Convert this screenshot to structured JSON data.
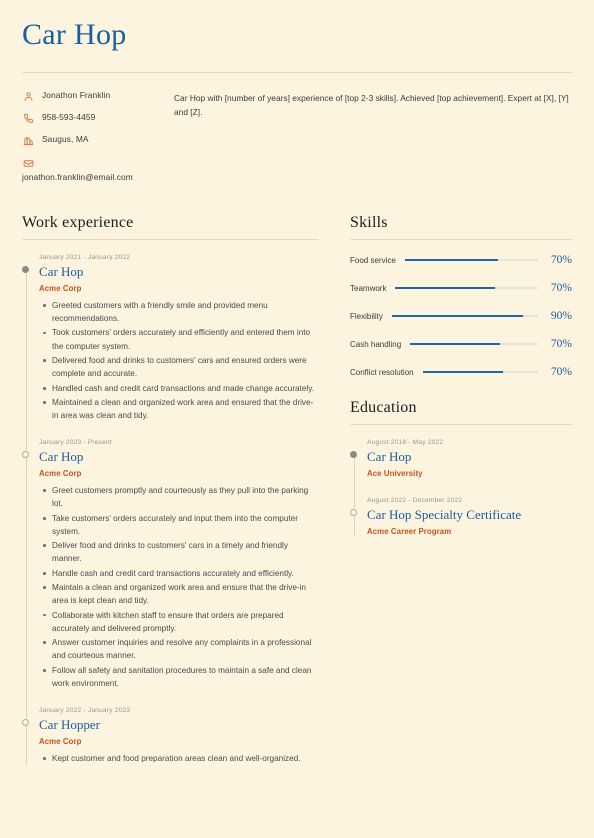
{
  "header": {
    "name_title": "Car Hop",
    "contacts": [
      {
        "icon": "person-icon",
        "text": "Jonathon Franklin"
      },
      {
        "icon": "phone-icon",
        "text": "958-593-4459"
      },
      {
        "icon": "location-icon",
        "text": "Saugus, MA"
      },
      {
        "icon": "email-icon",
        "text": "jonathon.franklin@email.com"
      }
    ],
    "summary": "Car Hop with [number of years] experience of [top 2-3 skills]. Achieved [top achievement]. Expert at [X], [Y] and [Z]."
  },
  "work": {
    "title": "Work experience",
    "entries": [
      {
        "marker": "filled",
        "date": "January 2021 - January 2022",
        "role": "Car Hop",
        "org": "Acme Corp",
        "bullets": [
          "Greeted customers with a friendly smile and provided menu recommendations.",
          "Took customers' orders accurately and efficiently and entered them into the computer system.",
          "Delivered food and drinks to customers' cars and ensured orders were complete and accurate.",
          "Handled cash and credit card transactions and made change accurately.",
          "Maintained a clean and organized work area and ensured that the drive-in area was clean and tidy."
        ]
      },
      {
        "marker": "hollow",
        "date": "January 2023 - Present",
        "role": "Car Hop",
        "org": "Acme Corp",
        "bullets": [
          "Greet customers promptly and courteously as they pull into the parking lot.",
          "Take customers' orders accurately and input them into the computer system.",
          "Deliver food and drinks to customers' cars in a timely and friendly manner.",
          "Handle cash and credit card transactions accurately and efficiently.",
          "Maintain a clean and organized work area and ensure that the drive-in area is kept clean and tidy.",
          "Collaborate with kitchen staff to ensure that orders are prepared accurately and delivered promptly.",
          "Answer customer inquiries and resolve any complaints in a professional and courteous manner.",
          "Follow all safety and sanitation procedures to maintain a safe and clean work environment."
        ]
      },
      {
        "marker": "hollow",
        "date": "January 2022 - January 2023",
        "role": "Car Hopper",
        "org": "Acme Corp",
        "bullets": [
          "Kept customer and food preparation areas clean and well-organized."
        ]
      }
    ]
  },
  "skills": {
    "title": "Skills",
    "items": [
      {
        "name": "Food service",
        "percent_label": "70%",
        "value": 70
      },
      {
        "name": "Teamwork",
        "percent_label": "70%",
        "value": 70
      },
      {
        "name": "Flexibility",
        "percent_label": "90%",
        "value": 90
      },
      {
        "name": "Cash handling",
        "percent_label": "70%",
        "value": 70
      },
      {
        "name": "Conflict resolution",
        "percent_label": "70%",
        "value": 70
      }
    ]
  },
  "education": {
    "title": "Education",
    "entries": [
      {
        "marker": "filled",
        "date": "August 2018 - May 2022",
        "degree": "Car Hop",
        "school": "Ace University"
      },
      {
        "marker": "hollow",
        "date": "August 2022 - December 2022",
        "degree": "Car Hop Specialty Certificate",
        "school": "Acme Career Program"
      }
    ]
  },
  "colors": {
    "background": "#fdf4e0",
    "heading_blue": "#1b5ea0",
    "accent_orange": "#c8501b",
    "skill_bar": "#1f6aa5",
    "rule": "#e4dac4"
  }
}
